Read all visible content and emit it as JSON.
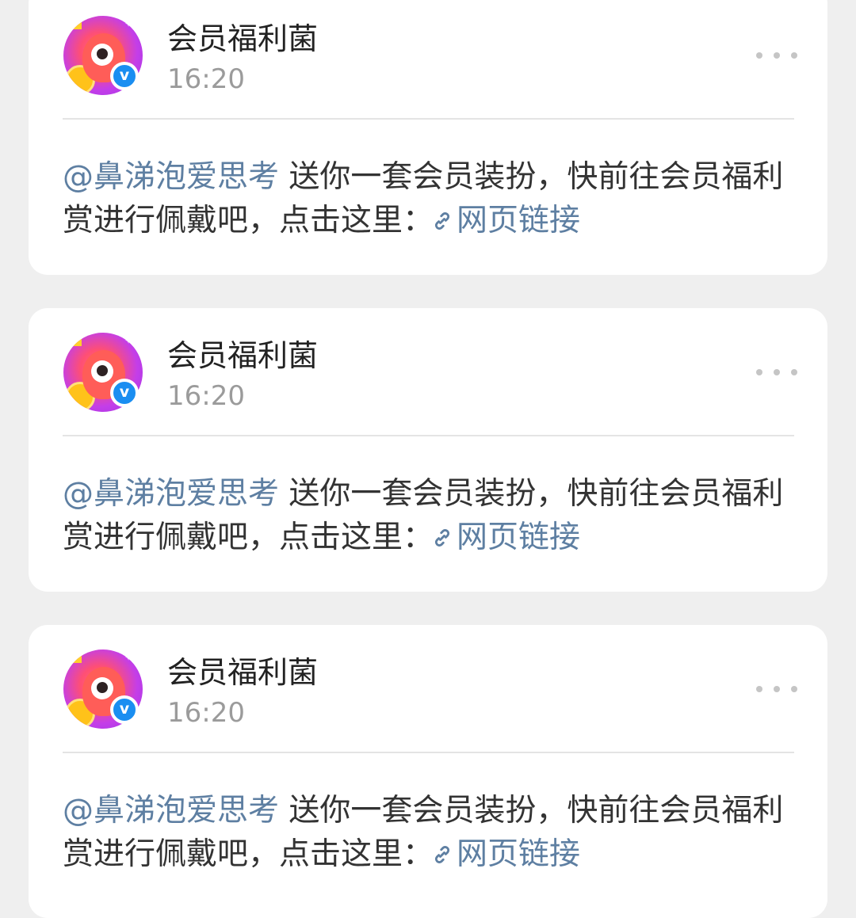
{
  "theme": {
    "background": "#efefef",
    "card": "#ffffff",
    "link": "#5e7fa2",
    "verified": "#1a8ef1",
    "muted": "#9b9b9b"
  },
  "cards": [
    {
      "author": "会员福利菌",
      "time": "16:20",
      "mention": "@鼻涕泡爱思考",
      "message": "送你一套会员装扮，快前往会员福利赏进行佩戴吧，点击这里：",
      "link_label": "网页链接",
      "verified_icon": "v",
      "link_icon": "link-icon"
    },
    {
      "author": "会员福利菌",
      "time": "16:20",
      "mention": "@鼻涕泡爱思考",
      "message": "送你一套会员装扮，快前往会员福利赏进行佩戴吧，点击这里：",
      "link_label": "网页链接",
      "verified_icon": "v",
      "link_icon": "link-icon"
    },
    {
      "author": "会员福利菌",
      "time": "16:20",
      "mention": "@鼻涕泡爱思考",
      "message": "送你一套会员装扮，快前往会员福利赏进行佩戴吧，点击这里：",
      "link_label": "网页链接",
      "verified_icon": "v",
      "link_icon": "link-icon"
    }
  ]
}
